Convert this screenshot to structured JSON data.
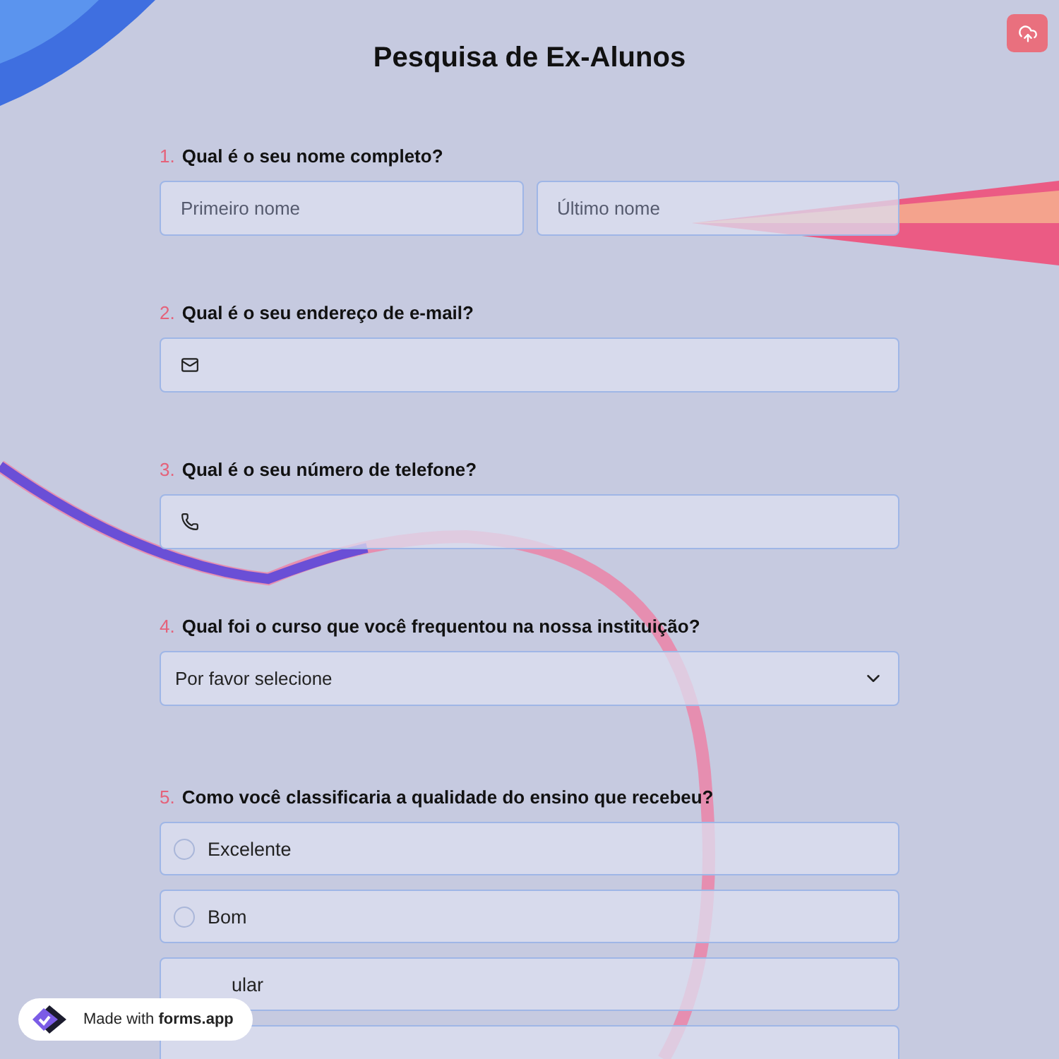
{
  "title": "Pesquisa de Ex-Alunos",
  "questions": [
    {
      "number": "1.",
      "label": "Qual é o seu nome completo?",
      "kind": "name",
      "placeholders": [
        "Primeiro nome",
        "Último nome"
      ]
    },
    {
      "number": "2.",
      "label": "Qual é o seu endereço de e-mail?",
      "kind": "email"
    },
    {
      "number": "3.",
      "label": "Qual é o seu número de telefone?",
      "kind": "phone"
    },
    {
      "number": "4.",
      "label": "Qual foi o curso que você frequentou na nossa instituição?",
      "kind": "select",
      "value": "Por favor selecione"
    },
    {
      "number": "5.",
      "label": "Como você classificaria a qualidade do ensino que recebeu?",
      "kind": "radio",
      "options": [
        {
          "label": "Excelente",
          "selected": false,
          "kind": "full"
        },
        {
          "label": "Bom",
          "selected": false,
          "kind": "full"
        },
        {
          "label": "ular",
          "selected": false,
          "kind": "partial"
        },
        {
          "selected": false,
          "kind": "empty"
        }
      ]
    }
  ],
  "badge": {
    "prefix": "Made with",
    "brand": "forms.app"
  }
}
